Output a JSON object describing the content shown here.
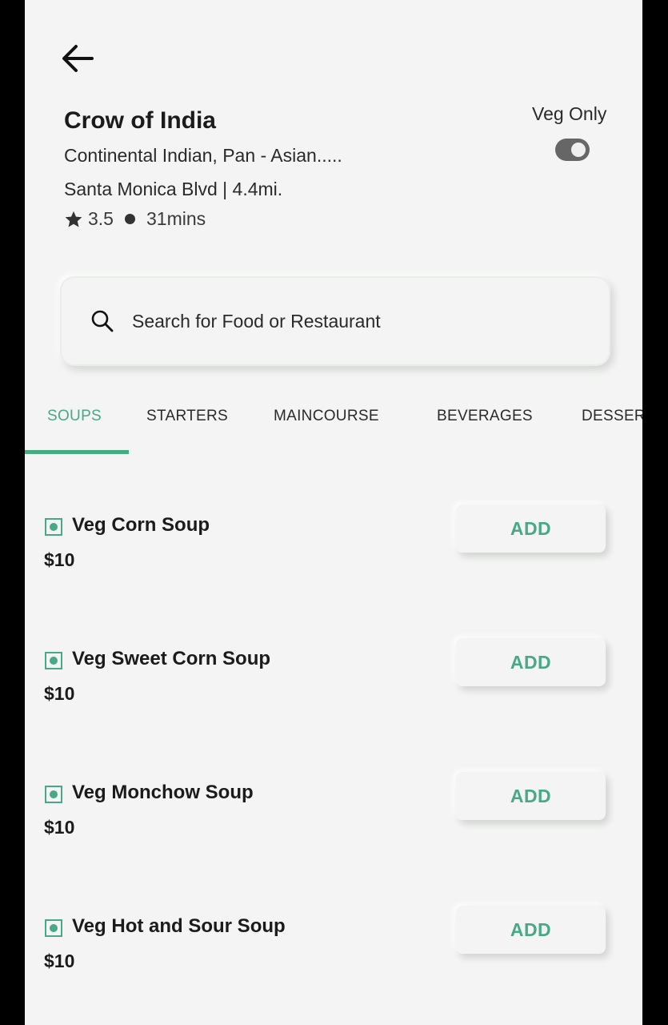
{
  "restaurant": {
    "name": "Crow of India",
    "cuisine": "Continental Indian, Pan - Asian.....",
    "address": "Santa Monica Blvd | 4.4mi.",
    "rating": "3.5",
    "time": "31mins"
  },
  "filter": {
    "veg_only_label": "Veg Only",
    "veg_only": true
  },
  "search": {
    "placeholder": "Search for Food or Restaurant"
  },
  "tabs": [
    {
      "label": "SOUPS",
      "active": true
    },
    {
      "label": "STARTERS"
    },
    {
      "label": "MAINCOURSE"
    },
    {
      "label": "BEVERAGES"
    },
    {
      "label": "DESSERTS"
    }
  ],
  "items": [
    {
      "name": "Veg Corn Soup",
      "price": "$10",
      "button": "ADD"
    },
    {
      "name": "Veg Sweet Corn Soup",
      "price": "$10",
      "button": "ADD"
    },
    {
      "name": "Veg Monchow Soup",
      "price": "$10",
      "button": "ADD"
    },
    {
      "name": "Veg Hot and Sour Soup",
      "price": "$10",
      "button": "ADD"
    }
  ],
  "colors": {
    "accent": "#48a986",
    "background": "#f3f4f3",
    "text": "#1b1b1b"
  },
  "icons": [
    "back-arrow-icon",
    "star-icon",
    "search-icon",
    "veg-indicator-icon"
  ]
}
